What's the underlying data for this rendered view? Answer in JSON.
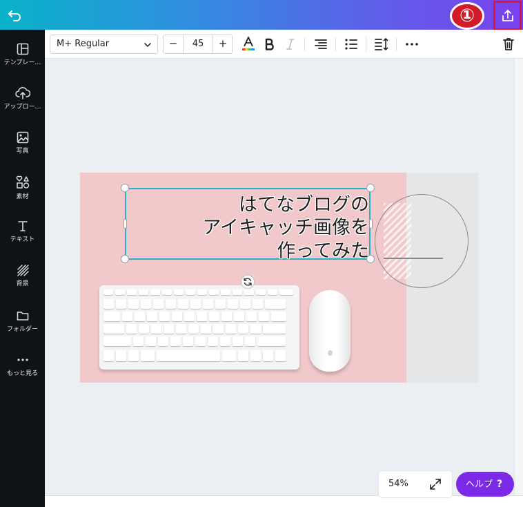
{
  "topbar": {
    "annotation_badge": "①"
  },
  "sidebar": {
    "items": [
      {
        "label": "テンプレー…",
        "icon": "templates-icon"
      },
      {
        "label": "アップロー…",
        "icon": "upload-icon"
      },
      {
        "label": "写真",
        "icon": "photos-icon"
      },
      {
        "label": "素材",
        "icon": "elements-icon"
      },
      {
        "label": "テキスト",
        "icon": "text-icon"
      },
      {
        "label": "背景",
        "icon": "background-icon"
      },
      {
        "label": "フォルダー",
        "icon": "folder-icon"
      },
      {
        "label": "もっと見る",
        "icon": "more-icon"
      }
    ]
  },
  "toolbar": {
    "font_name": "M+ Regular",
    "minus": "−",
    "font_size": "45",
    "plus": "+"
  },
  "design": {
    "text_lines": [
      "はてなブログの",
      "アイキャッチ画像を",
      "作ってみた"
    ]
  },
  "bottom": {
    "zoom": "54%",
    "help_label": "ヘルプ",
    "help_q": "?"
  },
  "colors": {
    "accent_purple": "#7d2ae8",
    "selection_cyan": "#23b3c6",
    "annotation_red": "#e0172b",
    "sidebar_bg": "#0e1318",
    "design_pink": "#f1c9cb"
  }
}
